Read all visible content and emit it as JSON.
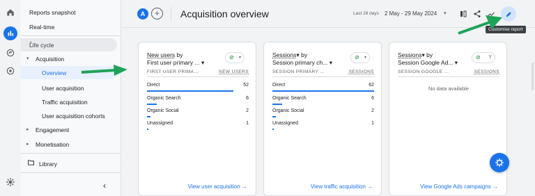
{
  "sidebar": {
    "reports_snapshot": "Reports snapshot",
    "real_time": "Real-time",
    "section": "Life cycle",
    "acquisition": "Acquisition",
    "overview": "Overview",
    "user_acquisition": "User acquisition",
    "traffic_acquisition": "Traffic acquisition",
    "user_acquisition_cohorts": "User acquisition cohorts",
    "engagement": "Engagement",
    "monetisation": "Monetisation",
    "library": "Library"
  },
  "header": {
    "avatar": "A",
    "title": "Acquisition overview",
    "date_label": "Last 28 days",
    "date_range": "2 May - 29 May 2024",
    "tooltip": "Customise report"
  },
  "cards": [
    {
      "title_metric": "New users",
      "title_by": "by",
      "title_dim": "First user primary ...",
      "col_left": "FIRST USER PRIMA...",
      "col_right": "NEW USERS",
      "rows": [
        {
          "label": "Direct",
          "value": "52"
        },
        {
          "label": "Organic Search",
          "value": "6"
        },
        {
          "label": "Organic Social",
          "value": "2"
        },
        {
          "label": "Unassigned",
          "value": "1"
        }
      ],
      "link": "View user acquisition →"
    },
    {
      "title_metric": "Sessions",
      "title_by": "by",
      "title_dim": "Session primary ch...",
      "col_left": "SESSION PRIMARY ...",
      "col_right": "SESSIONS",
      "rows": [
        {
          "label": "Direct",
          "value": "62"
        },
        {
          "label": "Organic Search",
          "value": "6"
        },
        {
          "label": "Organic Social",
          "value": "2"
        },
        {
          "label": "Unassigned",
          "value": "1"
        }
      ],
      "link": "View traffic acquisition →"
    },
    {
      "title_metric": "Sessions",
      "title_by": "by",
      "title_dim": "Session Google Ad...",
      "col_left": "SESSION GOOGLE ...",
      "col_right": "SESSIONS",
      "empty": "No data available",
      "link": "View Google Ads campaigns →"
    }
  ],
  "colors": {
    "accent": "#1a73e8",
    "arrow": "#1ea35a",
    "status_ok": "#188038"
  }
}
